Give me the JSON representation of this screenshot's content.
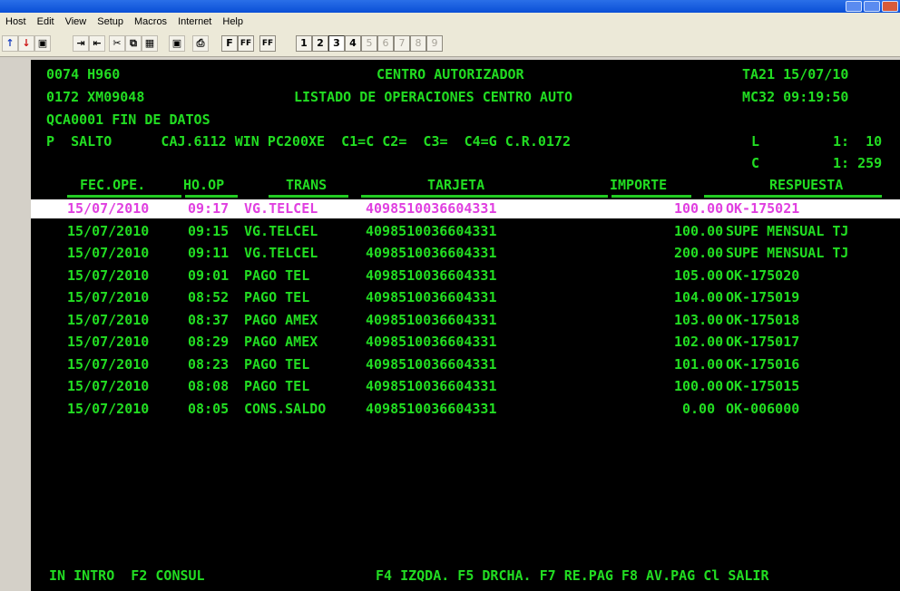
{
  "menu": [
    "Host",
    "Edit",
    "View",
    "Setup",
    "Macros",
    "Internet",
    "Help"
  ],
  "toolbar": {
    "font_buttons": [
      "F",
      "FF",
      "FF"
    ],
    "session_buttons": [
      "1",
      "2",
      "3",
      "4",
      "5",
      "6",
      "7",
      "8",
      "9"
    ],
    "active_session": "3"
  },
  "header": {
    "line1_left": "0074 H960",
    "line1_center": "CENTRO AUTORIZADOR",
    "line1_right": "TA21 15/07/10",
    "line2_left": "0172 XM09048",
    "line2_center": "LISTADO DE OPERACIONES CENTRO AUTO",
    "line2_right": "MC32 09:19:50",
    "line3": "QCA0001 FIN DE DATOS",
    "line4": "P  SALTO      CAJ.6112 WIN PC200XE  C1=C C2=  C3=  C4=G C.R.0172",
    "line4_l": "L",
    "line4_l_val": "1:  10",
    "line5_c": "C",
    "line5_c_val": "1: 259"
  },
  "columns": [
    "FEC.OPE.",
    "HO.OP",
    "TRANS",
    "TARJETA",
    "IMPORTE",
    "RESPUESTA"
  ],
  "rows": [
    {
      "fecha": "15/07/2010",
      "hora": "09:17",
      "trans": "VG.TELCEL",
      "tarjeta": "4098510036604331",
      "importe": "100.00",
      "respuesta": "OK-175021"
    },
    {
      "fecha": "15/07/2010",
      "hora": "09:15",
      "trans": "VG.TELCEL",
      "tarjeta": "4098510036604331",
      "importe": "100.00",
      "respuesta": "SUPE MENSUAL TJ"
    },
    {
      "fecha": "15/07/2010",
      "hora": "09:11",
      "trans": "VG.TELCEL",
      "tarjeta": "4098510036604331",
      "importe": "200.00",
      "respuesta": "SUPE MENSUAL TJ"
    },
    {
      "fecha": "15/07/2010",
      "hora": "09:01",
      "trans": "PAGO TEL",
      "tarjeta": "4098510036604331",
      "importe": "105.00",
      "respuesta": "OK-175020"
    },
    {
      "fecha": "15/07/2010",
      "hora": "08:52",
      "trans": "PAGO TEL",
      "tarjeta": "4098510036604331",
      "importe": "104.00",
      "respuesta": "OK-175019"
    },
    {
      "fecha": "15/07/2010",
      "hora": "08:37",
      "trans": "PAGO AMEX",
      "tarjeta": "4098510036604331",
      "importe": "103.00",
      "respuesta": "OK-175018"
    },
    {
      "fecha": "15/07/2010",
      "hora": "08:29",
      "trans": "PAGO AMEX",
      "tarjeta": "4098510036604331",
      "importe": "102.00",
      "respuesta": "OK-175017"
    },
    {
      "fecha": "15/07/2010",
      "hora": "08:23",
      "trans": "PAGO TEL",
      "tarjeta": "4098510036604331",
      "importe": "101.00",
      "respuesta": "OK-175016"
    },
    {
      "fecha": "15/07/2010",
      "hora": "08:08",
      "trans": "PAGO TEL",
      "tarjeta": "4098510036604331",
      "importe": "100.00",
      "respuesta": "OK-175015"
    },
    {
      "fecha": "15/07/2010",
      "hora": "08:05",
      "trans": "CONS.SALDO",
      "tarjeta": "4098510036604331",
      "importe": "0.00",
      "respuesta": "OK-006000"
    }
  ],
  "footer": {
    "keys_left": "IN INTRO  F2 CONSUL",
    "keys_right": "F4 IZQDA. F5 DRCHA. F7 RE.PAG F8 AV.PAG Cl SALIR"
  },
  "colors": {
    "terminal_bg": "#000000",
    "text_green": "#22dd22",
    "highlight_magenta": "#e040e0",
    "highlight_bg": "#ffffff"
  }
}
